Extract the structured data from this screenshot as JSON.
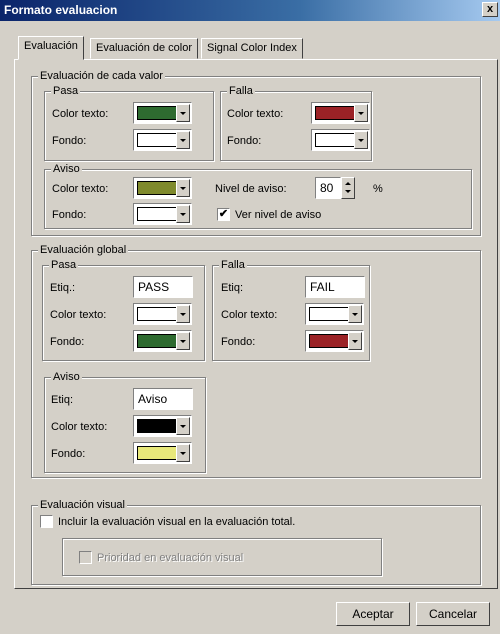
{
  "window": {
    "title": "Formato evaluacion",
    "close_glyph": "x"
  },
  "tabs": [
    {
      "label": "Evaluación",
      "active": true
    },
    {
      "label": "Evaluación de color"
    },
    {
      "label": "Signal Color Index"
    }
  ],
  "each_value": {
    "legend": "Evaluación de cada valor",
    "pass": {
      "legend": "Pasa",
      "text_color_label": "Color texto:",
      "text_color": "#2e6b30",
      "bg_label": "Fondo:",
      "bg_color": "#ffffff"
    },
    "fail": {
      "legend": "Falla",
      "text_color_label": "Color texto:",
      "text_color": "#9b2226",
      "bg_label": "Fondo:",
      "bg_color": "#ffffff"
    },
    "warn": {
      "legend": "Aviso",
      "text_color_label": "Color texto:",
      "text_color": "#7f8a2c",
      "bg_label": "Fondo:",
      "bg_color": "#ffffff",
      "level_label": "Nivel de aviso:",
      "level_value": "80",
      "level_unit": "%",
      "show_level_label": "Ver nivel de aviso",
      "show_level_checked": true
    }
  },
  "global": {
    "legend": "Evaluación global",
    "pass": {
      "legend": "Pasa",
      "label_label": "Etiq.:",
      "label_value": "PASS",
      "text_color_label": "Color texto:",
      "text_color": "#ffffff",
      "bg_label": "Fondo:",
      "bg_color": "#2e6b30"
    },
    "fail": {
      "legend": "Falla",
      "label_label": "Etiq:",
      "label_value": "FAIL",
      "text_color_label": "Color texto:",
      "text_color": "#ffffff",
      "bg_label": "Fondo:",
      "bg_color": "#9b2226"
    },
    "warn": {
      "legend": "Aviso",
      "label_label": "Etiq:",
      "label_value": "Aviso",
      "text_color_label": "Color texto:",
      "text_color": "#000000",
      "bg_label": "Fondo:",
      "bg_color": "#e8e87a"
    }
  },
  "visual": {
    "legend": "Evaluación visual",
    "include_label": "Incluir la evaluación visual en la evaluación total.",
    "include_checked": false,
    "priority_label": "Prioridad en evaluación visual",
    "priority_checked": false
  },
  "buttons": {
    "ok": "Aceptar",
    "cancel": "Cancelar"
  }
}
